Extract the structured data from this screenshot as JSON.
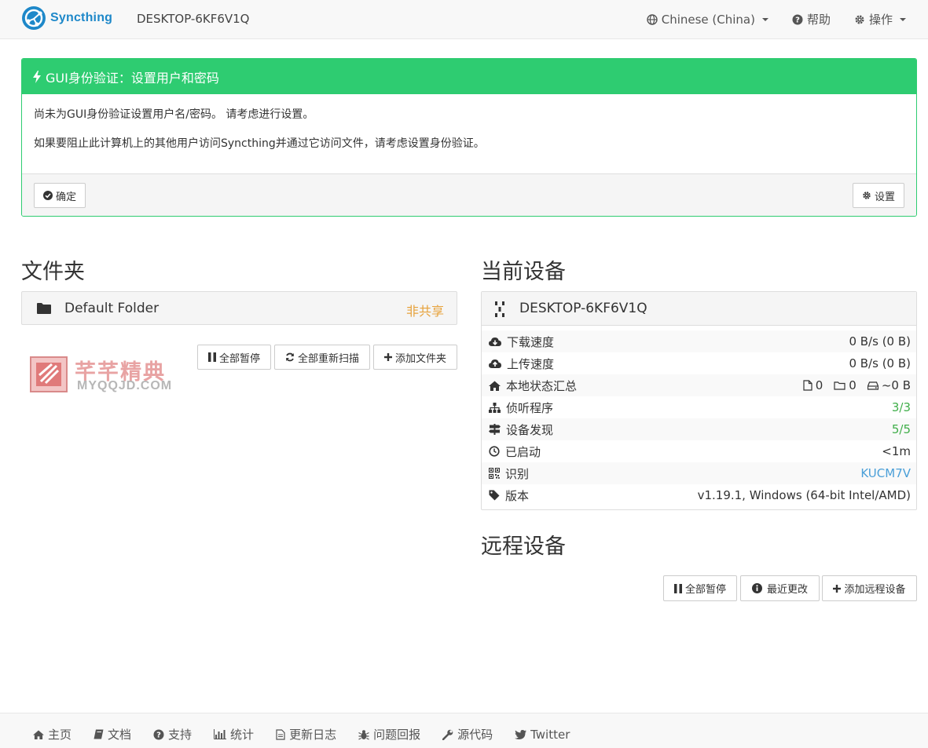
{
  "navbar": {
    "brand": "Syncthing",
    "device_name": "DESKTOP-6KF6V1Q",
    "language": "Chinese (China)",
    "help": "帮助",
    "actions": "操作"
  },
  "alert": {
    "title": "GUI身份验证：设置用户和密码",
    "line1": "尚未为GUI身份验证设置用户名/密码。 请考虑进行设置。",
    "line2": "如果要阻止此计算机上的其他用户访问Syncthing并通过它访问文件，请考虑设置身份验证。",
    "ok_label": "确定",
    "settings_label": "设置"
  },
  "folders": {
    "heading": "文件夹",
    "items": [
      {
        "name": "Default Folder",
        "status": "非共享"
      }
    ],
    "pause_all": "全部暂停",
    "rescan_all": "全部重新扫描",
    "add_folder": "添加文件夹"
  },
  "watermark": {
    "text": "芊芊精典",
    "sub": "MYQQJD.COM"
  },
  "this_device": {
    "heading": "当前设备",
    "name": "DESKTOP-6KF6V1Q",
    "rows": [
      {
        "label": "下载速度",
        "value": "0 B/s (0 B)",
        "icon": "cloud-download-icon"
      },
      {
        "label": "上传速度",
        "value": "0 B/s (0 B)",
        "icon": "cloud-upload-icon"
      },
      {
        "label": "本地状态汇总",
        "value_files": "0",
        "value_folders": "0",
        "value_size": "~0 B",
        "icon": "home-icon"
      },
      {
        "label": "侦听程序",
        "value": "3/3",
        "icon": "sitemap-icon",
        "color": "#3fae49"
      },
      {
        "label": "设备发现",
        "value": "5/5",
        "icon": "signpost-icon",
        "color": "#3fae49"
      },
      {
        "label": "已启动",
        "value": "<1m",
        "icon": "clock-icon"
      },
      {
        "label": "识别",
        "value": "KUCM7V",
        "icon": "qrcode-icon",
        "color": "#4a9fd8"
      },
      {
        "label": "版本",
        "value": "v1.19.1, Windows (64-bit Intel/AMD)",
        "icon": "tag-icon"
      }
    ]
  },
  "remote_devices": {
    "heading": "远程设备",
    "pause_all": "全部暂停",
    "recent_changes": "最近更改",
    "add_device": "添加远程设备"
  },
  "footer": {
    "links": [
      "主页",
      "文档",
      "支持",
      "统计",
      "更新日志",
      "问题回报",
      "源代码",
      "Twitter"
    ]
  }
}
